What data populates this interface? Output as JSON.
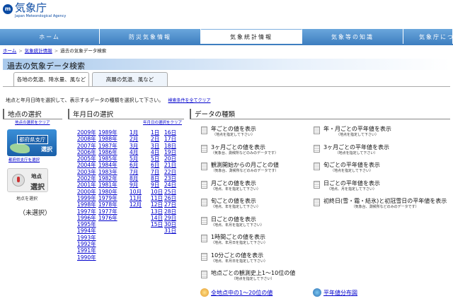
{
  "header": {
    "logo_mark": "m",
    "logo_name": "気象庁",
    "logo_en": "Japan Meteorological Agency"
  },
  "nav": [
    {
      "label": "ホーム"
    },
    {
      "label": "防災気象情報"
    },
    {
      "label": "気象統計情報",
      "active": true
    },
    {
      "label": "気象等の知識"
    },
    {
      "label": "気象庁につ"
    }
  ],
  "breadcrumb": {
    "home": "ホーム",
    "stats": "気象統計情報",
    "current": "過去の気象データ検索",
    "sep": ">"
  },
  "page_title": "過去の気象データ検索",
  "tabs": {
    "surface": "各地の気温、降水量、風など",
    "upper": "高層の気温、風など"
  },
  "instructions": {
    "text": "地点と年月日時を選択して、表示するデータの種類を選択して下さい。",
    "clear_link": "検索条件を全てクリア"
  },
  "station": {
    "header": "地点の選択",
    "clear_link": "地点の選択をクリア",
    "pref_label": "都府県支庁",
    "pref_select": "選択",
    "pref_link": "都府県支庁を選択",
    "point_label": "地点",
    "point_select": "選択",
    "point_link": "地点を選択",
    "selected": "（未選択）"
  },
  "date": {
    "header": "年月日の選択",
    "clear_link": "年月日の選択をクリア",
    "years_a": [
      "2009年",
      "2008年",
      "2007年",
      "2006年",
      "2005年",
      "2004年",
      "2003年",
      "2002年",
      "2001年",
      "2000年",
      "1999年",
      "1998年",
      "1997年",
      "1996年",
      "1995年",
      "1994年",
      "1993年",
      "1992年",
      "1991年",
      "1990年"
    ],
    "years_b": [
      "1989年",
      "1988年",
      "1987年",
      "1986年",
      "1985年",
      "1984年",
      "1983年",
      "1982年",
      "1981年",
      "1980年",
      "1979年",
      "1978年",
      "1977年",
      "1976年"
    ],
    "months": [
      "1月",
      "2月",
      "3月",
      "4月",
      "5月",
      "6月",
      "7月",
      "8月",
      "9月",
      "10月",
      "11月",
      "12月"
    ],
    "days_a": [
      "1日",
      "2日",
      "3日",
      "4日",
      "5日",
      "6日",
      "7日",
      "8日",
      "9日",
      "10日",
      "11日",
      "12日",
      "13日",
      "14日",
      "15日"
    ],
    "days_b": [
      "16日",
      "17日",
      "18日",
      "19日",
      "20日",
      "21日",
      "22日",
      "23日",
      "24日",
      "25日",
      "26日",
      "27日",
      "28日",
      "29日",
      "30日",
      "31日"
    ]
  },
  "datatype": {
    "header": "データの種類",
    "left": [
      {
        "label": "年ごとの値を表示",
        "sub": "（地点を指定して下さい）"
      },
      {
        "label": "3ヶ月ごとの値を表示",
        "sub": "（気象台、測候所などのみのデータです）"
      },
      {
        "label": "観測開始からの月ごとの値",
        "sub": "（気象台、測候所などのみのデータです）"
      },
      {
        "label": "月ごとの値を表示",
        "sub": "（地点、年を指定して下さい）"
      },
      {
        "label": "旬ごとの値を表示",
        "sub": "（地点、年を指定して下さい）"
      },
      {
        "label": "日ごとの値を表示",
        "sub": "（地点、年月を指定して下さい）"
      },
      {
        "label": "1時間ごとの値を表示",
        "sub": "（地点、年月日を指定して下さい）"
      },
      {
        "label": "10分ごとの値を表示",
        "sub": "（地点、年月日を指定して下さい）"
      },
      {
        "label": "地点ごとの観測史上1～10位の値",
        "sub": "（地点を指定して下さい）"
      }
    ],
    "right": [
      {
        "label": "年・月ごとの平年値を表示",
        "sub": "（地点を指定して下さい）"
      },
      {
        "label": "3ヶ月ごとの平年値を表示",
        "sub": "（地点を指定して下さい）"
      },
      {
        "label": "旬ごとの平年値を表示",
        "sub": "（地点を指定して下さい）"
      },
      {
        "label": "日ごとの平年値を表示",
        "sub": "（地点、月を指定して下さい）"
      },
      {
        "label": "初終日(雪・霜・結氷)と初冠雪日の平年値を表示",
        "sub": "（気象台、測候所などのみのデータです）"
      }
    ],
    "bottom_left": "全地点中の1～20位の値",
    "bottom_right": "平年値分布図"
  }
}
